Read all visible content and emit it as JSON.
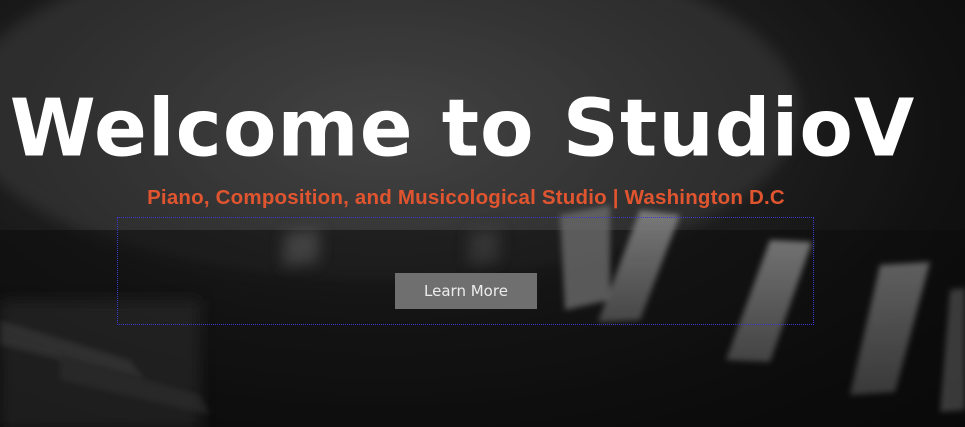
{
  "hero": {
    "title": "Welcome to StudioV",
    "subtitle": "Piano, Composition, and Musicological Studio | Washington D.C",
    "cta_label": "Learn More",
    "background_image": "piano-keys-photo"
  },
  "colors": {
    "subtitle": "#e0552f",
    "button_bg": "#6f6f6f",
    "title": "#ffffff",
    "selection_outline": "#3a3ad0"
  }
}
